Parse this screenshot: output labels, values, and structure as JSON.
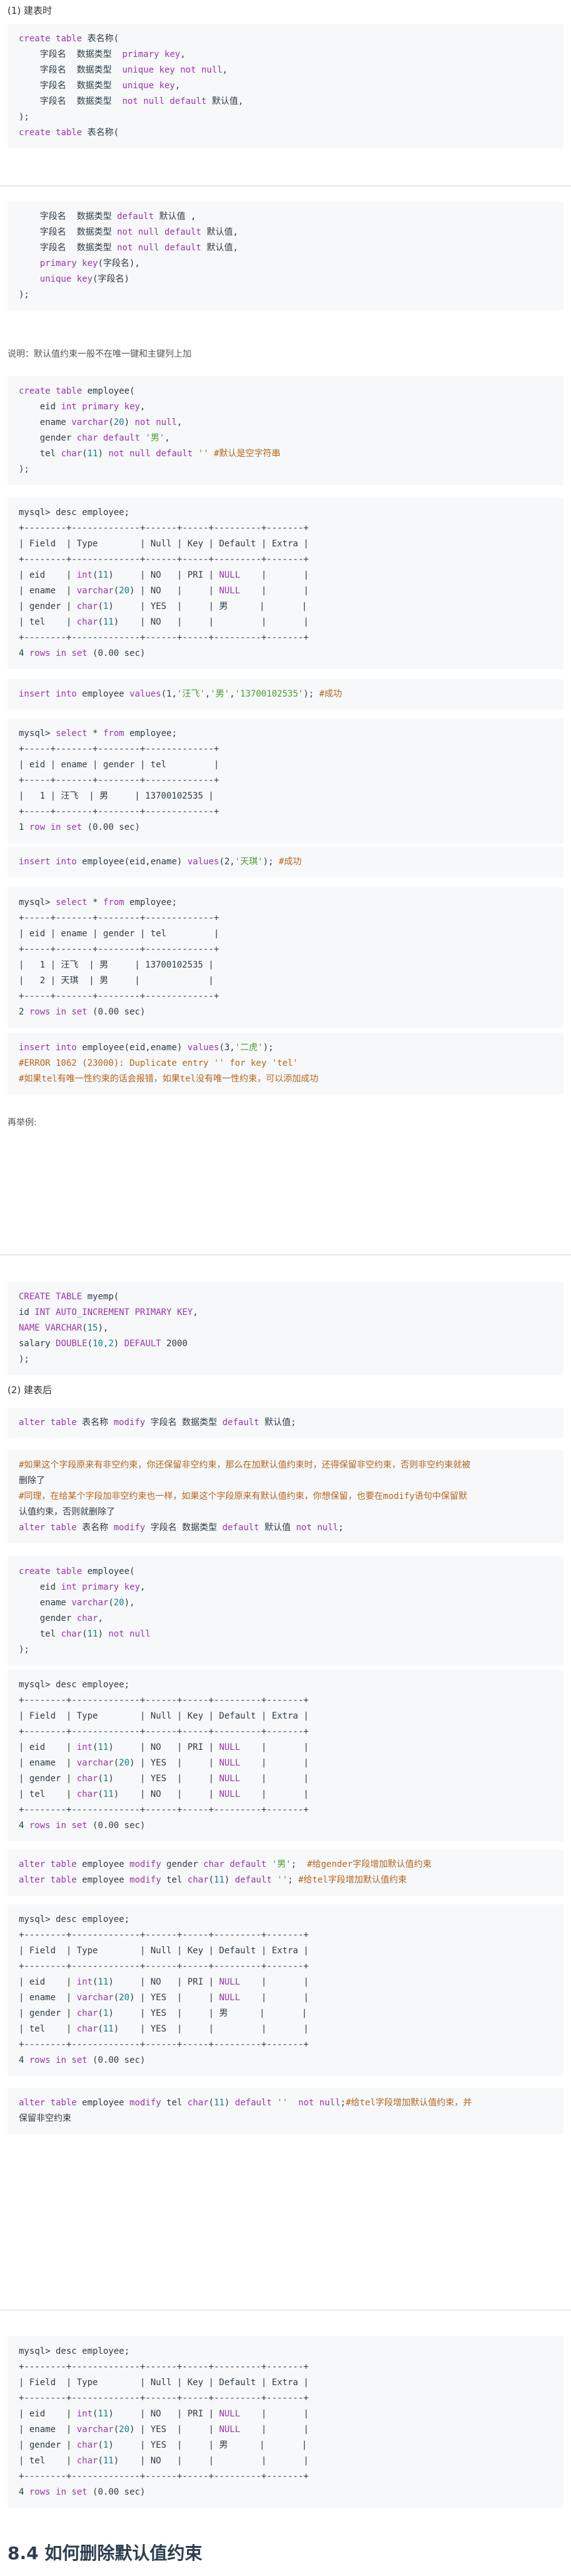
{
  "s1": {
    "heading": "(1) 建表时",
    "code1": [
      "create table 表名称(",
      "    字段名  数据类型  primary key,",
      "    字段名  数据类型  unique key not null,",
      "    字段名  数据类型  unique key,",
      "    字段名  数据类型  not null default 默认值,",
      ");",
      "create table 表名称("
    ],
    "code2": [
      "    字段名  数据类型 default 默认值 ,",
      "    字段名  数据类型 not null default 默认值,",
      "    字段名  数据类型 not null default 默认值,",
      "    primary key(字段名),",
      "    unique key(字段名)",
      ");"
    ],
    "note": "说明：默认值约束一般不在唯一键和主键列上加",
    "code3": [
      "create table employee(",
      "    eid int primary key,",
      "    ename varchar(20) not null,",
      "    gender char default '男',",
      "    tel char(11) not null default '' #默认是空字符串",
      ");"
    ],
    "code4": [
      "mysql> desc employee;",
      "+--------+-------------+------+-----+---------+-------+",
      "| Field  | Type        | Null | Key | Default | Extra |",
      "+--------+-------------+------+-----+---------+-------+",
      "| eid    | int(11)     | NO   | PRI | NULL    |       |",
      "| ename  | varchar(20) | NO   |     | NULL    |       |",
      "| gender | char(1)     | YES  |     | 男      |       |",
      "| tel    | char(11)    | NO   |     |         |       |",
      "+--------+-------------+------+-----+---------+-------+",
      "4 rows in set (0.00 sec)"
    ],
    "code5": [
      "insert into employee values(1,'汪飞','男','13700102535'); #成功"
    ],
    "code6": [
      "mysql> select * from employee;",
      "+-----+-------+--------+-------------+",
      "| eid | ename | gender | tel         |",
      "+-----+-------+--------+-------------+",
      "|   1 | 汪飞  | 男     | 13700102535 |",
      "+-----+-------+--------+-------------+",
      "1 row in set (0.00 sec)"
    ],
    "code7": [
      "insert into employee(eid,ename) values(2,'天琪'); #成功"
    ],
    "code8": [
      "mysql> select * from employee;",
      "+-----+-------+--------+-------------+",
      "| eid | ename | gender | tel         |",
      "+-----+-------+--------+-------------+",
      "|   1 | 汪飞  | 男     | 13700102535 |",
      "|   2 | 天琪  | 男     |             |",
      "+-----+-------+--------+-------------+",
      "2 rows in set (0.00 sec)"
    ],
    "code9": [
      "insert into employee(eid,ename) values(3,'二虎');",
      "#ERROR 1062 (23000): Duplicate entry '' for key 'tel'",
      "#如果tel有唯一性约束的话会报错，如果tel没有唯一性约束，可以添加成功"
    ],
    "example_label": "再举例:"
  },
  "s2": {
    "code1": [
      "CREATE TABLE myemp(",
      "id INT AUTO_INCREMENT PRIMARY KEY,",
      "NAME VARCHAR(15),",
      "salary DOUBLE(10,2) DEFAULT 2000",
      ");"
    ],
    "heading": "(2) 建表后",
    "code2": [
      "alter table 表名称 modify 字段名 数据类型 default 默认值;"
    ],
    "code3": [
      "#如果这个字段原来有非空约束，你还保留非空约束，那么在加默认值约束时，还得保留非空约束，否则非空约束就被",
      "删除了",
      "#同理，在给某个字段加非空约束也一样，如果这个字段原来有默认值约束，你想保留，也要在modify语句中保留默",
      "认值约束，否则就删除了",
      "alter table 表名称 modify 字段名 数据类型 default 默认值 not null;"
    ],
    "code4": [
      "create table employee(",
      "    eid int primary key,",
      "    ename varchar(20),",
      "    gender char,",
      "    tel char(11) not null",
      ");"
    ],
    "code5": [
      "mysql> desc employee;",
      "+--------+-------------+------+-----+---------+-------+",
      "| Field  | Type        | Null | Key | Default | Extra |",
      "+--------+-------------+------+-----+---------+-------+",
      "| eid    | int(11)     | NO   | PRI | NULL    |       |",
      "| ename  | varchar(20) | YES  |     | NULL    |       |",
      "| gender | char(1)     | YES  |     | NULL    |       |",
      "| tel    | char(11)    | NO   |     | NULL    |       |",
      "+--------+-------------+------+-----+---------+-------+",
      "4 rows in set (0.00 sec)"
    ],
    "code6": [
      "alter table employee modify gender char default '男';  #给gender字段增加默认值约束",
      "alter table employee modify tel char(11) default ''; #给tel字段增加默认值约束"
    ],
    "code7": [
      "mysql> desc employee;",
      "+--------+-------------+------+-----+---------+-------+",
      "| Field  | Type        | Null | Key | Default | Extra |",
      "+--------+-------------+------+-----+---------+-------+",
      "| eid    | int(11)     | NO   | PRI | NULL    |       |",
      "| ename  | varchar(20) | YES  |     | NULL    |       |",
      "| gender | char(1)     | YES  |     | 男      |       |",
      "| tel    | char(11)    | YES  |     |         |       |",
      "+--------+-------------+------+-----+---------+-------+",
      "4 rows in set (0.00 sec)"
    ],
    "code8": [
      "alter table employee modify tel char(11) default ''  not null;#给tel字段增加默认值约束，并",
      "保留非空约束"
    ]
  },
  "s3": {
    "code1": [
      "mysql> desc employee;",
      "+--------+-------------+------+-----+---------+-------+",
      "| Field  | Type        | Null | Key | Default | Extra |",
      "+--------+-------------+------+-----+---------+-------+",
      "| eid    | int(11)     | NO   | PRI | NULL    |       |",
      "| ename  | varchar(20) | YES  |     | NULL    |       |",
      "| gender | char(1)     | YES  |     | 男      |       |",
      "| tel    | char(11)    | NO   |     |         |       |",
      "+--------+-------------+------+-----+---------+-------+",
      "4 rows in set (0.00 sec)"
    ],
    "heading": "8.4 如何删除默认值约束"
  }
}
